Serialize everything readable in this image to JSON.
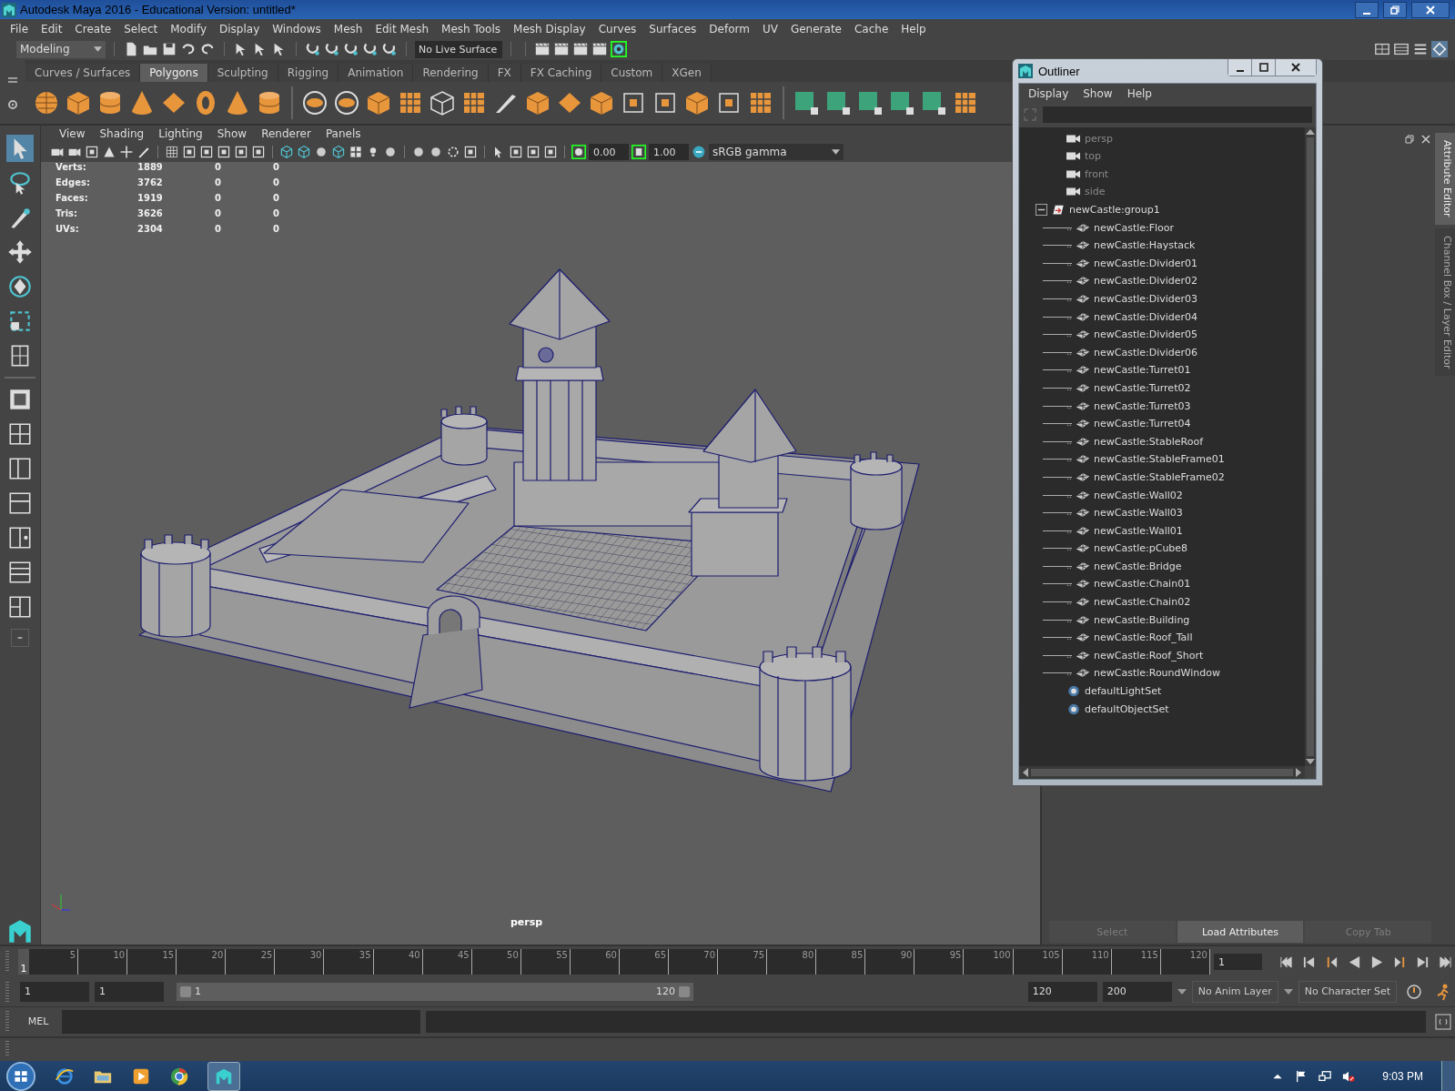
{
  "window": {
    "title": "Autodesk Maya 2016 - Educational Version: untitled*"
  },
  "menu_bar": [
    "File",
    "Edit",
    "Create",
    "Select",
    "Modify",
    "Display",
    "Windows",
    "Mesh",
    "Edit Mesh",
    "Mesh Tools",
    "Mesh Display",
    "Curves",
    "Surfaces",
    "Deform",
    "UV",
    "Generate",
    "Cache",
    "Help"
  ],
  "status_line": {
    "mode": "Modeling",
    "live_surface": "No Live Surface"
  },
  "shelf": {
    "tabs": [
      {
        "label": "Curves / Surfaces",
        "selected": false
      },
      {
        "label": "Polygons",
        "selected": true
      },
      {
        "label": "Sculpting",
        "selected": false
      },
      {
        "label": "Rigging",
        "selected": false
      },
      {
        "label": "Animation",
        "selected": false
      },
      {
        "label": "Rendering",
        "selected": false
      },
      {
        "label": "FX",
        "selected": false
      },
      {
        "label": "FX Caching",
        "selected": false
      },
      {
        "label": "Custom",
        "selected": false
      },
      {
        "label": "XGen",
        "selected": false
      }
    ]
  },
  "toolbox": {
    "tools": [
      {
        "kind": "select",
        "selected": true
      },
      {
        "kind": "lasso",
        "selected": false
      },
      {
        "kind": "paint",
        "selected": false
      },
      {
        "kind": "move",
        "selected": false
      },
      {
        "kind": "rotate",
        "selected": false
      },
      {
        "kind": "scale",
        "selected": false
      },
      {
        "kind": "last",
        "selected": false
      }
    ]
  },
  "viewport": {
    "menus": [
      "View",
      "Shading",
      "Lighting",
      "Show",
      "Renderer",
      "Panels"
    ],
    "exposure": "0.00",
    "gamma": "1.00",
    "color_space": "sRGB gamma",
    "hud": [
      {
        "label": "Verts:",
        "values": [
          "1889",
          "0",
          "0"
        ]
      },
      {
        "label": "Edges:",
        "values": [
          "3762",
          "0",
          "0"
        ]
      },
      {
        "label": "Faces:",
        "values": [
          "1919",
          "0",
          "0"
        ]
      },
      {
        "label": "Tris:",
        "values": [
          "3626",
          "0",
          "0"
        ]
      },
      {
        "label": "UVs:",
        "values": [
          "2304",
          "0",
          "0"
        ]
      }
    ],
    "camera": "persp"
  },
  "outliner": {
    "title": "Outliner",
    "menus": [
      "Display",
      "Show",
      "Help"
    ],
    "items": [
      {
        "label": "persp",
        "kind": "camera"
      },
      {
        "label": "top",
        "kind": "camera"
      },
      {
        "label": "front",
        "kind": "camera"
      },
      {
        "label": "side",
        "kind": "camera"
      },
      {
        "label": "newCastle:group1",
        "kind": "group",
        "expanded": true,
        "children": [
          {
            "label": "newCastle:Floor",
            "kind": "mesh"
          },
          {
            "label": "newCastle:Haystack",
            "kind": "mesh"
          },
          {
            "label": "newCastle:Divider01",
            "kind": "mesh"
          },
          {
            "label": "newCastle:Divider02",
            "kind": "mesh"
          },
          {
            "label": "newCastle:Divider03",
            "kind": "mesh"
          },
          {
            "label": "newCastle:Divider04",
            "kind": "mesh"
          },
          {
            "label": "newCastle:Divider05",
            "kind": "mesh"
          },
          {
            "label": "newCastle:Divider06",
            "kind": "mesh"
          },
          {
            "label": "newCastle:Turret01",
            "kind": "mesh"
          },
          {
            "label": "newCastle:Turret02",
            "kind": "mesh"
          },
          {
            "label": "newCastle:Turret03",
            "kind": "mesh"
          },
          {
            "label": "newCastle:Turret04",
            "kind": "mesh"
          },
          {
            "label": "newCastle:StableRoof",
            "kind": "mesh"
          },
          {
            "label": "newCastle:StableFrame01",
            "kind": "mesh"
          },
          {
            "label": "newCastle:StableFrame02",
            "kind": "mesh"
          },
          {
            "label": "newCastle:Wall02",
            "kind": "mesh"
          },
          {
            "label": "newCastle:Wall03",
            "kind": "mesh"
          },
          {
            "label": "newCastle:Wall01",
            "kind": "mesh"
          },
          {
            "label": "newCastle:pCube8",
            "kind": "mesh"
          },
          {
            "label": "newCastle:Bridge",
            "kind": "mesh"
          },
          {
            "label": "newCastle:Chain01",
            "kind": "mesh"
          },
          {
            "label": "newCastle:Chain02",
            "kind": "mesh"
          },
          {
            "label": "newCastle:Building",
            "kind": "mesh"
          },
          {
            "label": "newCastle:Roof_Tall",
            "kind": "mesh"
          },
          {
            "label": "newCastle:Roof_Short",
            "kind": "mesh"
          },
          {
            "label": "newCastle:RoundWindow",
            "kind": "mesh"
          }
        ]
      },
      {
        "label": "defaultLightSet",
        "kind": "set"
      },
      {
        "label": "defaultObjectSet",
        "kind": "set"
      }
    ]
  },
  "side_panel": {
    "tabs": [
      {
        "label": "Attribute Editor",
        "selected": true
      },
      {
        "label": "Channel Box / Layer Editor",
        "selected": false
      }
    ],
    "buttons": [
      {
        "label": "Select",
        "disabled": true
      },
      {
        "label": "Load Attributes",
        "disabled": false
      },
      {
        "label": "Copy Tab",
        "disabled": true
      }
    ]
  },
  "time_slider": {
    "current_frame": "1",
    "level": 0,
    "ticks": [
      "5",
      "10",
      "15",
      "20",
      "25",
      "30",
      "35",
      "40",
      "45",
      "50",
      "55",
      "60",
      "65",
      "70",
      "75",
      "80",
      "85",
      "90",
      "95",
      "100",
      "105",
      "110",
      "115",
      "120"
    ],
    "current_time": "1"
  },
  "range_slider": {
    "handles": [
      {
        "level": 0
      },
      {
        "level": 1
      }
    ],
    "start_time": "1",
    "playback_start": "1",
    "range_start": "1",
    "range_end": "120",
    "playback_end": "120",
    "end_time": "200",
    "anim_layer": "No Anim Layer",
    "character_set": "No Character Set"
  },
  "command_line": {
    "label": "MEL"
  },
  "taskbar": {
    "clock": "9:03 PM"
  }
}
